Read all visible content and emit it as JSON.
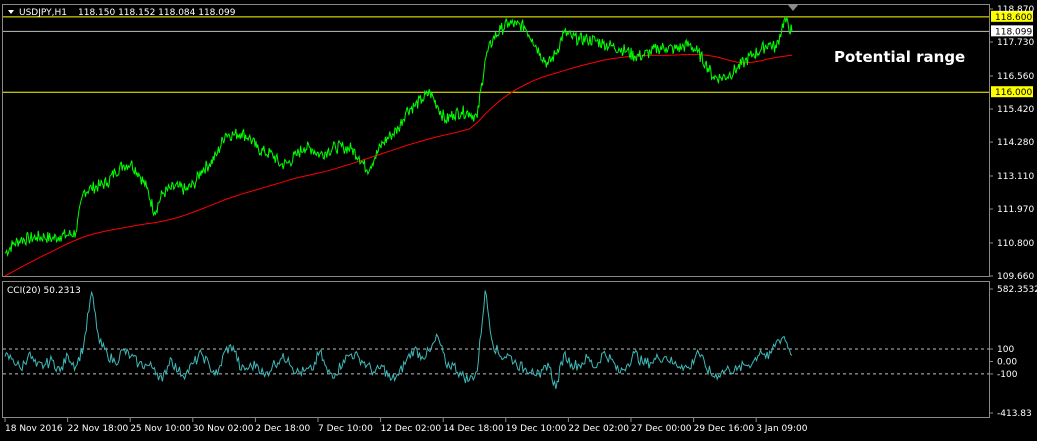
{
  "chart_data": [
    {
      "type": "line",
      "header": {
        "symbol": "USDJPY,H1",
        "ohlc": "118.150 118.152 118.084 118.099"
      },
      "annotation": "Potential range",
      "ylim": [
        109.66,
        118.87
      ],
      "y_ticks": [
        "118.870",
        "117.730",
        "116.560",
        "115.420",
        "114.280",
        "113.110",
        "111.970",
        "110.800",
        "109.660"
      ],
      "hlines": [
        {
          "label": "118.600",
          "value": 118.6,
          "color": "#ffff00"
        },
        {
          "label": "116.000",
          "value": 116.0,
          "color": "#ffff00"
        }
      ],
      "current_price": {
        "label": "118.099",
        "value": 118.099,
        "color": "#c0c0c0"
      },
      "x_labels": [
        "18 Nov 2016",
        "22 Nov 18:00",
        "25 Nov 10:00",
        "30 Nov 02:00",
        "2 Dec 18:00",
        "7 Dec 10:00",
        "12 Dec 02:00",
        "14 Dec 18:00",
        "19 Dec 10:00",
        "22 Dec 02:00",
        "27 Dec 00:00",
        "29 Dec 16:00",
        "3 Jan 09:00"
      ],
      "series": [
        {
          "kind": "price",
          "color": "#00ff00",
          "values": [
            110.45,
            110.75,
            110.92,
            110.95,
            111.0,
            111.01,
            110.95,
            111.05,
            111.07,
            111.16,
            112.58,
            112.69,
            112.78,
            112.88,
            113.26,
            113.48,
            113.55,
            113.2,
            112.7,
            111.86,
            112.5,
            112.66,
            112.73,
            112.62,
            112.82,
            113.32,
            113.52,
            113.9,
            114.58,
            114.53,
            114.6,
            114.45,
            114.08,
            113.93,
            113.85,
            113.49,
            113.56,
            113.82,
            114.1,
            114.05,
            113.85,
            113.98,
            114.1,
            114.1,
            114.05,
            113.78,
            113.32,
            113.75,
            114.25,
            114.51,
            114.75,
            115.37,
            115.52,
            115.75,
            116.0,
            115.51,
            115.02,
            115.25,
            115.32,
            115.3,
            115.12,
            117.11,
            117.84,
            118.16,
            118.38,
            118.31,
            118.27,
            117.85,
            117.35,
            116.95,
            117.35,
            118.05,
            117.9,
            117.82,
            117.82,
            117.78,
            117.68,
            117.6,
            117.52,
            117.42,
            117.24,
            117.27,
            117.38,
            117.52,
            117.55,
            117.48,
            117.55,
            117.65,
            117.38,
            117.0,
            116.53,
            116.5,
            116.6,
            116.82,
            117.05,
            117.3,
            117.45,
            117.68,
            117.52,
            118.5,
            118.1
          ],
          "label_points": [
            {
              "x": "18 Nov 2016",
              "y": 110.45
            },
            {
              "x": "22 Nov 18:00",
              "y": 112.58
            },
            {
              "x": "25 Nov 10:00",
              "y": 112.5
            },
            {
              "x": "30 Nov 02:00",
              "y": 114.58
            },
            {
              "x": "2 Dec 18:00",
              "y": 113.49
            },
            {
              "x": "7 Dec 10:00",
              "y": 113.85
            },
            {
              "x": "12 Dec 02:00",
              "y": 115.52
            },
            {
              "x": "14 Dec 18:00",
              "y": 115.12
            },
            {
              "x": "19 Dec 10:00",
              "y": 117.35
            },
            {
              "x": "22 Dec 02:00",
              "y": 117.78
            },
            {
              "x": "27 Dec 00:00",
              "y": 117.27
            },
            {
              "x": "29 Dec 16:00",
              "y": 116.53
            },
            {
              "x": "3 Jan 09:00",
              "y": 117.68
            }
          ]
        },
        {
          "kind": "moving-average",
          "color": "#ff0000",
          "values": [
            109.66,
            109.81,
            109.96,
            110.1,
            110.24,
            110.38,
            110.51,
            110.65,
            110.78,
            110.9,
            111.01,
            111.09,
            111.16,
            111.22,
            111.27,
            111.32,
            111.37,
            111.42,
            111.46,
            111.5,
            111.55,
            111.61,
            111.68,
            111.77,
            111.87,
            111.97,
            112.08,
            112.19,
            112.3,
            112.39,
            112.48,
            112.56,
            112.64,
            112.72,
            112.8,
            112.88,
            112.96,
            113.04,
            113.1,
            113.16,
            113.22,
            113.29,
            113.36,
            113.45,
            113.53,
            113.62,
            113.71,
            113.8,
            113.89,
            113.98,
            114.07,
            114.16,
            114.24,
            114.32,
            114.4,
            114.47,
            114.53,
            114.59,
            114.66,
            114.73,
            114.95,
            115.24,
            115.5,
            115.73,
            115.93,
            116.1,
            116.25,
            116.38,
            116.49,
            116.58,
            116.66,
            116.74,
            116.82,
            116.9,
            116.97,
            117.04,
            117.1,
            117.15,
            117.19,
            117.22,
            117.24,
            117.26,
            117.27,
            117.27,
            117.27,
            117.28,
            117.29,
            117.3,
            117.3,
            117.28,
            117.24,
            117.18,
            117.1,
            117.04,
            117.02,
            117.03,
            117.08,
            117.15,
            117.2,
            117.24,
            117.28
          ]
        }
      ]
    },
    {
      "type": "line",
      "header": "CCI(20) 50.2313",
      "ylim": [
        -413.83,
        582.3532
      ],
      "y_ticks": [
        "582.3532",
        "100",
        "0.00",
        "-100",
        "-413.83"
      ],
      "levels": [
        100,
        -100
      ],
      "series": [
        {
          "kind": "cci",
          "color": "#3fb8b8",
          "values": [
            40,
            20,
            -60,
            60,
            -40,
            -30,
            10,
            -80,
            50,
            -40,
            130,
            555,
            150,
            60,
            -10,
            90,
            40,
            -20,
            -30,
            -50,
            -160,
            30,
            -80,
            -100,
            -10,
            60,
            -40,
            -110,
            90,
            120,
            -70,
            -50,
            -20,
            -120,
            -30,
            20,
            30,
            -90,
            -80,
            -70,
            80,
            -90,
            -100,
            10,
            60,
            30,
            -30,
            -90,
            -40,
            -150,
            -110,
            10,
            100,
            40,
            80,
            200,
            -20,
            -30,
            -110,
            -150,
            -80,
            570,
            140,
            40,
            50,
            -20,
            -60,
            -60,
            -130,
            -10,
            -220,
            60,
            -20,
            -30,
            30,
            -50,
            70,
            20,
            -90,
            -30,
            70,
            -10,
            -10,
            30,
            40,
            -20,
            -30,
            -60,
            90,
            -40,
            -120,
            -90,
            -60,
            -70,
            -30,
            -10,
            90,
            20,
            160,
            200,
            50
          ]
        }
      ]
    }
  ]
}
